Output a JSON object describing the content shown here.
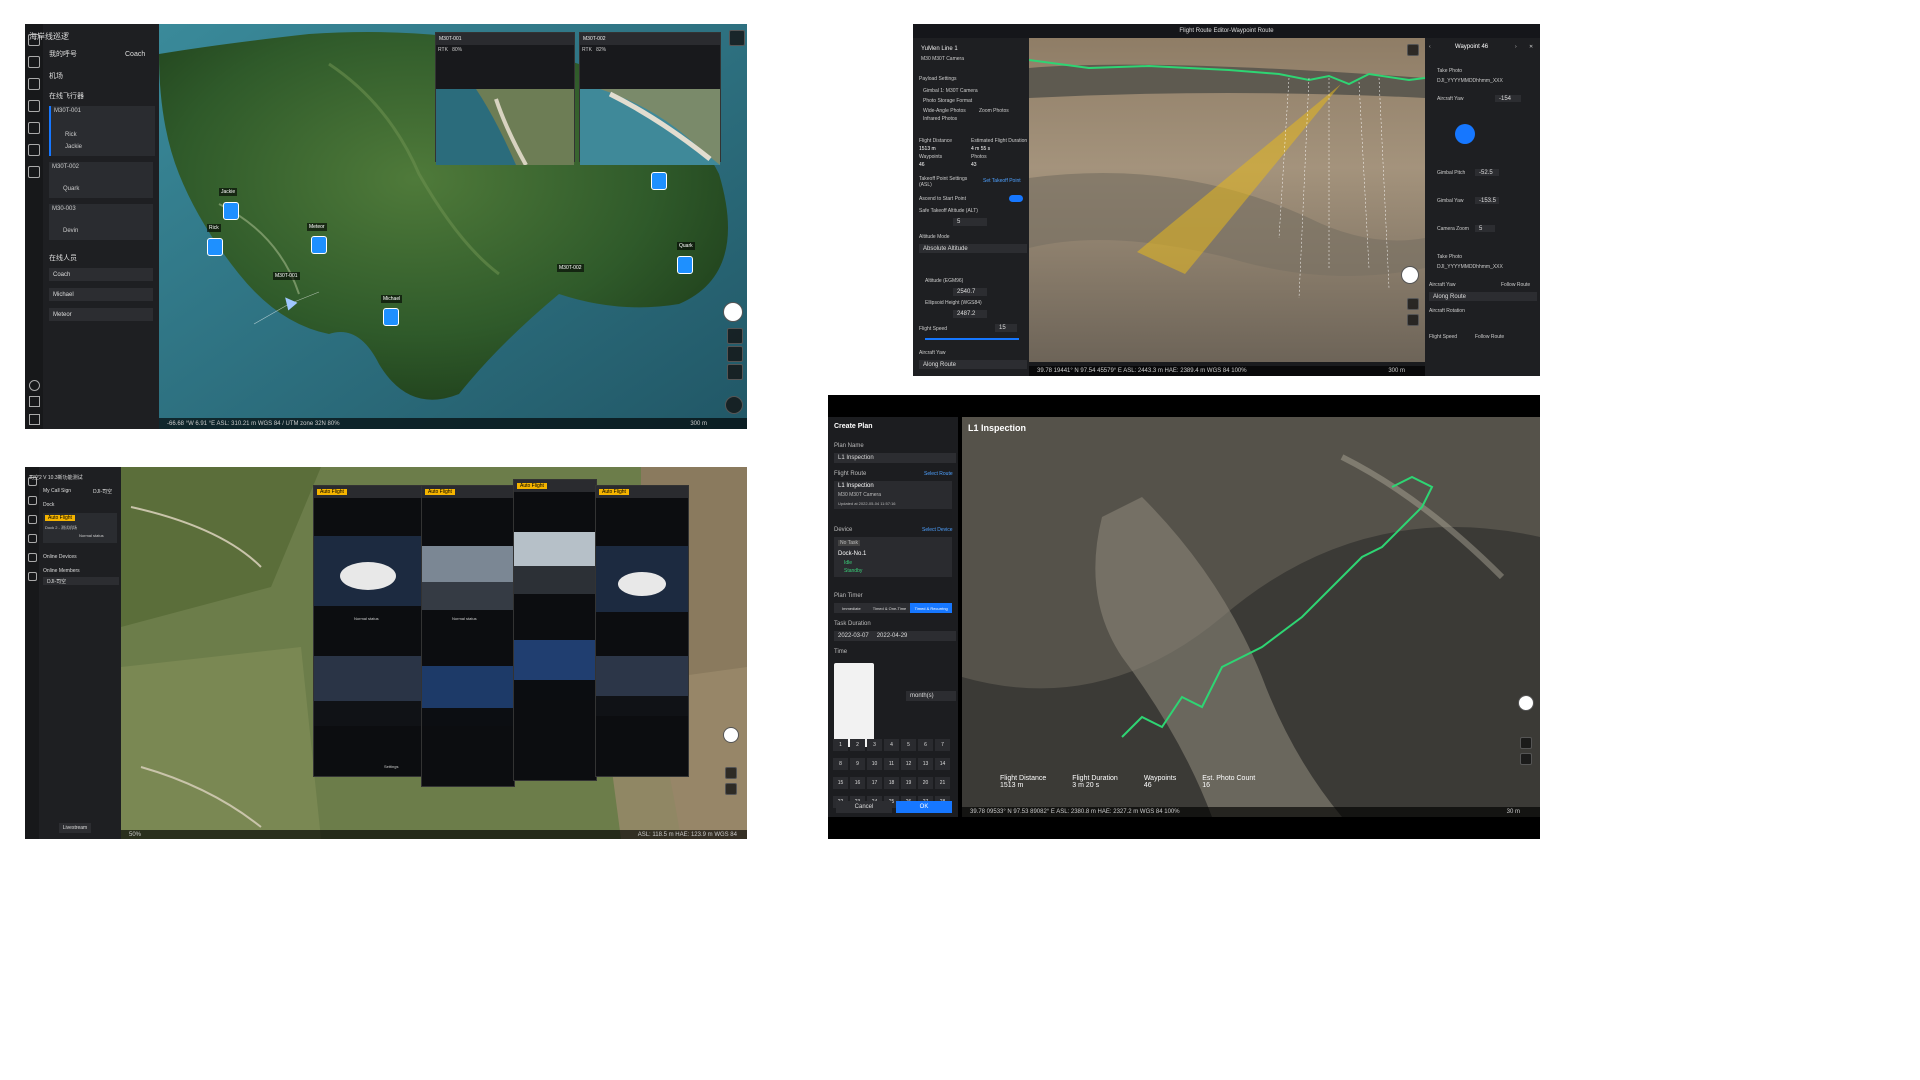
{
  "p1": {
    "title": "海岸线巡逻",
    "callsign_label": "我的呼号",
    "callsign_value": "Coach",
    "section_aircraft": "机场",
    "section_online": "在线飞行器",
    "devices": [
      {
        "name": "M30T-001",
        "pilot": "Rick",
        "gimbal": "Jackie"
      },
      {
        "name": "M30T-002",
        "pilot": "Quark",
        "gimbal": ""
      },
      {
        "name": "M30-003",
        "pilot": "Devin",
        "gimbal": ""
      }
    ],
    "online_people_label": "在线人员",
    "people": [
      "Coach",
      "Michael",
      "Meteor"
    ],
    "map_labels": [
      "Jackie",
      "Rick",
      "Meteor",
      "Michael",
      "Quark",
      "M30T-001",
      "M30T-002"
    ],
    "video_titles": [
      "M30T-001",
      "M30T-002"
    ],
    "video_vals": [
      "RTK",
      "80%",
      "82%"
    ],
    "status": "-66.68  °W  6.91  °E  ASL: 310.21 m  WGS 84 / UTM zone 32N  80%",
    "scale": "300 m"
  },
  "p2": {
    "window_title": "Flight Route Editor-Waypoint Route",
    "route_name": "YuMen Line 1",
    "drone": "M30  M30T Camera",
    "payload_settings": "Payload Settings",
    "gimbal": "Gimbal 1: M30T Camera",
    "photo_format": "Photo Storage Format",
    "opt_wide": "Wide-Angle Photos",
    "opt_zoom": "Zoom Photos",
    "opt_ir": "Infrared Photos",
    "flight_distance_label": "Flight Distance",
    "flight_distance": "1513 m",
    "duration_label": "Estimated Flight Duration",
    "duration": "4 m 55 s",
    "waypoints_label": "Waypoints",
    "waypoints": "46",
    "photos_label": "Photos",
    "photos": "43",
    "takeoff": "Takeoff Point Settings (ASL)",
    "set_takeoff": "Set Takeoff Point",
    "ascend": "Ascend to Start Point",
    "safe_alt": "Safe Takeoff Altitude (ALT)",
    "safe_alt_val": "5",
    "alt_mode": "Altitude Mode",
    "alt_mode_val": "Absolute Altitude",
    "alt_egm": "Altitude (EGM96)",
    "alt_egm_val": "2540.7",
    "ellipsoid": "Ellipsoid Height (WGS84)",
    "ellipsoid_val": "2487.2",
    "flight_speed": "Flight Speed",
    "flight_speed_val": "15",
    "aircraft_yaw": "Aircraft Yaw",
    "yaw_val": "Along Route",
    "waypoint_title": "Waypoint 46",
    "actions": [
      "Take Photo",
      "Aircraft Yaw",
      "Gimbal Pitch",
      "Gimbal Yaw",
      "Camera Zoom",
      "Take Photo"
    ],
    "photo_file": "DJI_YYYYMMDDhhmm_XXX",
    "yaw_value": "-154",
    "pitch_value": "-52.5",
    "gyaw_value": "-153.5",
    "zoom_value": "5",
    "right_yaw": "Along Route",
    "follow_route": "Follow Route",
    "aircraft_rotation": "Aircraft Rotation",
    "status": "39.78  19441° N  97.54  45579° E  ASL: 2443.3 m  HAE: 2389.4 m  WGS 84  100%",
    "scale": "300 m"
  },
  "p3": {
    "title": "司空2 V 10.3新功能测试",
    "callsign": "My Call Sign",
    "callsign_value": "DJI-司空",
    "dock": "Dock",
    "dock_item": "Dock 2 - 测试机场",
    "online_devices": "Online Devices",
    "online_members": "Online Members",
    "member": "DJI-司空",
    "auto_flight": "Auto Flight",
    "normal": "Normal status",
    "settings": "Settings",
    "livestream": "Livestream",
    "status": "50%",
    "asl": "ASL: 118.5 m  HAE: 123.9 m  WGS 84"
  },
  "p4": {
    "header": "Create Plan",
    "plan_name_label": "Plan Name",
    "plan_name": "L1 Inspection",
    "route_label": "Flight Route",
    "select_route": "Select Route",
    "route_name": "L1 Inspection",
    "route_drone": "M30  M30T Camera",
    "route_updated": "Updated at 2022-05-04 11:57:16",
    "device_label": "Device",
    "select_device": "Select Device",
    "device_tag": "No Task",
    "dock_name": "Dock-No.1",
    "dock_status": "Idle",
    "dock_standby": "Standby",
    "timer_label": "Plan Timer",
    "timer_opts": [
      "Immediate",
      "Timed & One-Time",
      "Timed & Recurring"
    ],
    "duration_label": "Task Duration",
    "date_start": "2022-03-07",
    "date_end": "2022-04-29",
    "time_label": "Time",
    "repeat_unit": "month(s)",
    "cancel": "Cancel",
    "ok": "OK",
    "map_title": "L1 Inspection",
    "stats": [
      {
        "label": "Flight Distance",
        "value": "1513 m"
      },
      {
        "label": "Flight Duration",
        "value": "3 m 20 s"
      },
      {
        "label": "Waypoints",
        "value": "46"
      },
      {
        "label": "Est. Photo Count",
        "value": "16"
      }
    ],
    "status": "39.78  09533° N  97.53  89082° E  ASL: 2380.8 m  HAE: 2327.2 m  WGS 84  100%",
    "scale": "30 m",
    "cal_nums": [
      "1",
      "2",
      "3",
      "4",
      "5",
      "6",
      "7",
      "8",
      "9",
      "10",
      "11",
      "12",
      "13",
      "14",
      "15",
      "16",
      "17",
      "18",
      "19",
      "20",
      "21",
      "22",
      "23",
      "24",
      "25",
      "26",
      "27",
      "28"
    ]
  },
  "colors": {
    "accent": "#1677ff",
    "route_green": "#2ed573",
    "gimbal_yellow": "#e5b81e",
    "panel_bg": "#1e1f22"
  }
}
